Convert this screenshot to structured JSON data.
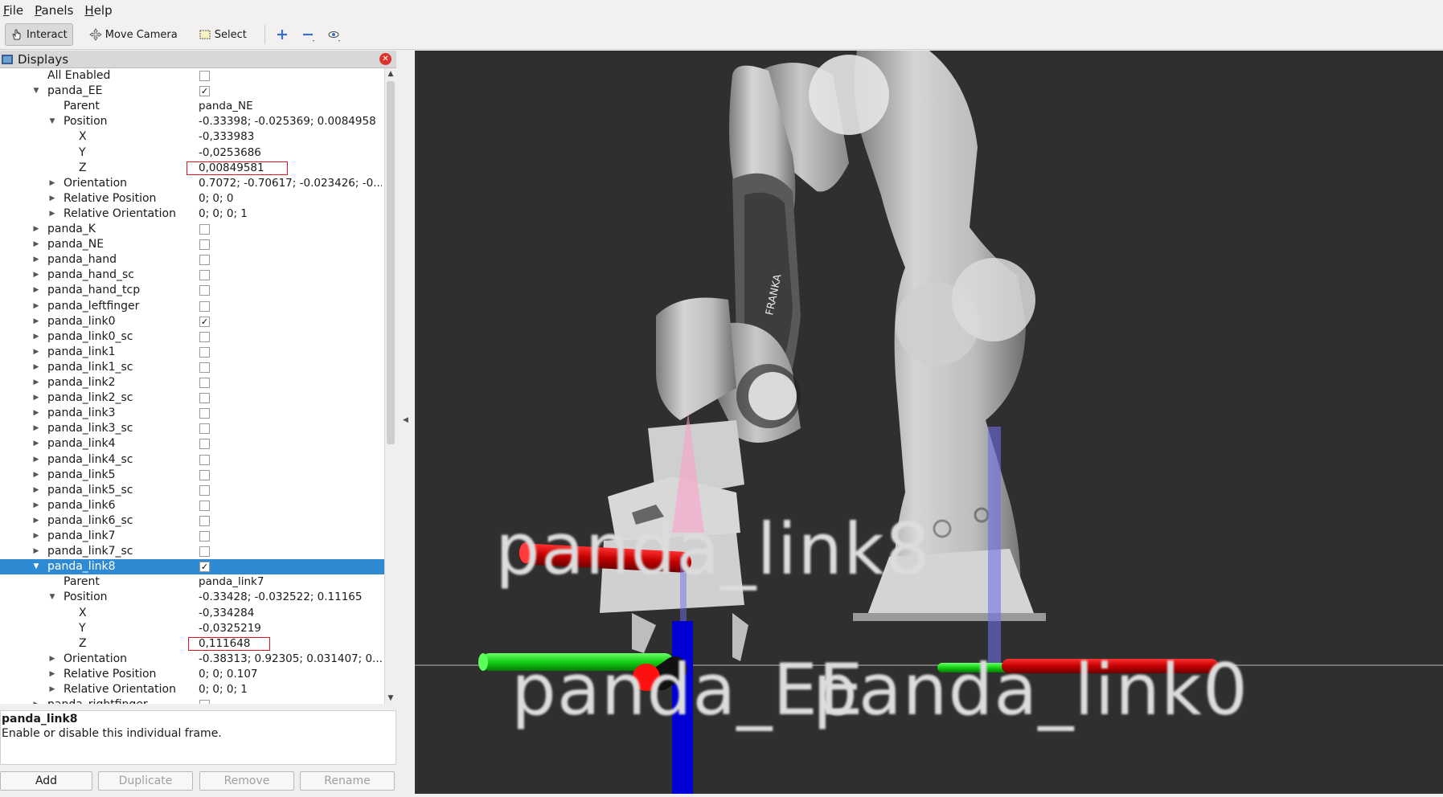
{
  "menubar": {
    "items": [
      {
        "label": "File",
        "underline": "F",
        "rest": "ile"
      },
      {
        "label": "Panels",
        "underline": "P",
        "rest": "anels"
      },
      {
        "label": "Help",
        "underline": "H",
        "rest": "elp"
      }
    ]
  },
  "toolbar": {
    "interact": "Interact",
    "move_camera": "Move Camera",
    "select": "Select"
  },
  "displays_panel": {
    "title": "Displays",
    "rows": [
      {
        "label": "All Enabled",
        "indent": 1,
        "arrow": "none",
        "check": false
      },
      {
        "label": "panda_EE",
        "indent": 1,
        "arrow": "down",
        "check": true
      },
      {
        "label": "Parent",
        "indent": 2,
        "arrow": "none",
        "value": "panda_NE"
      },
      {
        "label": "Position",
        "indent": 2,
        "arrow": "down",
        "value": "-0.33398; -0.025369; 0.0084958"
      },
      {
        "label": "X",
        "indent": 3,
        "arrow": "none",
        "value": "-0,333983"
      },
      {
        "label": "Y",
        "indent": 3,
        "arrow": "none",
        "value": "-0,0253686"
      },
      {
        "label": "Z",
        "indent": 3,
        "arrow": "none",
        "value": "0,00849581",
        "highlight": 1
      },
      {
        "label": "Orientation",
        "indent": 2,
        "arrow": "right",
        "value": "0.7072; -0.70617; -0.023426; -0...."
      },
      {
        "label": "Relative Position",
        "indent": 2,
        "arrow": "right",
        "value": "0; 0; 0"
      },
      {
        "label": "Relative Orientation",
        "indent": 2,
        "arrow": "right",
        "value": "0; 0; 0; 1"
      },
      {
        "label": "panda_K",
        "indent": 1,
        "arrow": "right",
        "check": false
      },
      {
        "label": "panda_NE",
        "indent": 1,
        "arrow": "right",
        "check": false
      },
      {
        "label": "panda_hand",
        "indent": 1,
        "arrow": "right",
        "check": false
      },
      {
        "label": "panda_hand_sc",
        "indent": 1,
        "arrow": "right",
        "check": false
      },
      {
        "label": "panda_hand_tcp",
        "indent": 1,
        "arrow": "right",
        "check": false
      },
      {
        "label": "panda_leftfinger",
        "indent": 1,
        "arrow": "right",
        "check": false
      },
      {
        "label": "panda_link0",
        "indent": 1,
        "arrow": "right",
        "check": true
      },
      {
        "label": "panda_link0_sc",
        "indent": 1,
        "arrow": "right",
        "check": false
      },
      {
        "label": "panda_link1",
        "indent": 1,
        "arrow": "right",
        "check": false
      },
      {
        "label": "panda_link1_sc",
        "indent": 1,
        "arrow": "right",
        "check": false
      },
      {
        "label": "panda_link2",
        "indent": 1,
        "arrow": "right",
        "check": false
      },
      {
        "label": "panda_link2_sc",
        "indent": 1,
        "arrow": "right",
        "check": false
      },
      {
        "label": "panda_link3",
        "indent": 1,
        "arrow": "right",
        "check": false
      },
      {
        "label": "panda_link3_sc",
        "indent": 1,
        "arrow": "right",
        "check": false
      },
      {
        "label": "panda_link4",
        "indent": 1,
        "arrow": "right",
        "check": false
      },
      {
        "label": "panda_link4_sc",
        "indent": 1,
        "arrow": "right",
        "check": false
      },
      {
        "label": "panda_link5",
        "indent": 1,
        "arrow": "right",
        "check": false
      },
      {
        "label": "panda_link5_sc",
        "indent": 1,
        "arrow": "right",
        "check": false
      },
      {
        "label": "panda_link6",
        "indent": 1,
        "arrow": "right",
        "check": false
      },
      {
        "label": "panda_link6_sc",
        "indent": 1,
        "arrow": "right",
        "check": false
      },
      {
        "label": "panda_link7",
        "indent": 1,
        "arrow": "right",
        "check": false
      },
      {
        "label": "panda_link7_sc",
        "indent": 1,
        "arrow": "right",
        "check": false
      },
      {
        "label": "panda_link8",
        "indent": 1,
        "arrow": "down",
        "check": true,
        "selected": true
      },
      {
        "label": "Parent",
        "indent": 2,
        "arrow": "none",
        "value": "panda_link7"
      },
      {
        "label": "Position",
        "indent": 2,
        "arrow": "down",
        "value": "-0.33428; -0.032522; 0.11165"
      },
      {
        "label": "X",
        "indent": 3,
        "arrow": "none",
        "value": "-0,334284"
      },
      {
        "label": "Y",
        "indent": 3,
        "arrow": "none",
        "value": "-0,0325219"
      },
      {
        "label": "Z",
        "indent": 3,
        "arrow": "none",
        "value": "0,111648",
        "highlight": 2
      },
      {
        "label": "Orientation",
        "indent": 2,
        "arrow": "right",
        "value": "-0.38313; 0.92305; 0.031407; 0...."
      },
      {
        "label": "Relative Position",
        "indent": 2,
        "arrow": "right",
        "value": "0; 0; 0.107"
      },
      {
        "label": "Relative Orientation",
        "indent": 2,
        "arrow": "right",
        "value": "0; 0; 0; 1"
      },
      {
        "label": "panda_rightfinger",
        "indent": 1,
        "arrow": "right",
        "check": false
      }
    ]
  },
  "description": {
    "title": "panda_link8",
    "text": "Enable or disable this individual frame."
  },
  "buttons": {
    "add": "Add",
    "duplicate": "Duplicate",
    "remove": "Remove",
    "rename": "Rename"
  },
  "view": {
    "labels": {
      "link8": "panda_link8",
      "ee": "panda_EE",
      "link0": "panda_link0"
    },
    "colors": {
      "background": "#2f2f2f",
      "x_axis": "#e00000",
      "y_axis": "#00e000",
      "z_axis": "#0000e0",
      "selected_row": "#2f8ad4"
    }
  }
}
